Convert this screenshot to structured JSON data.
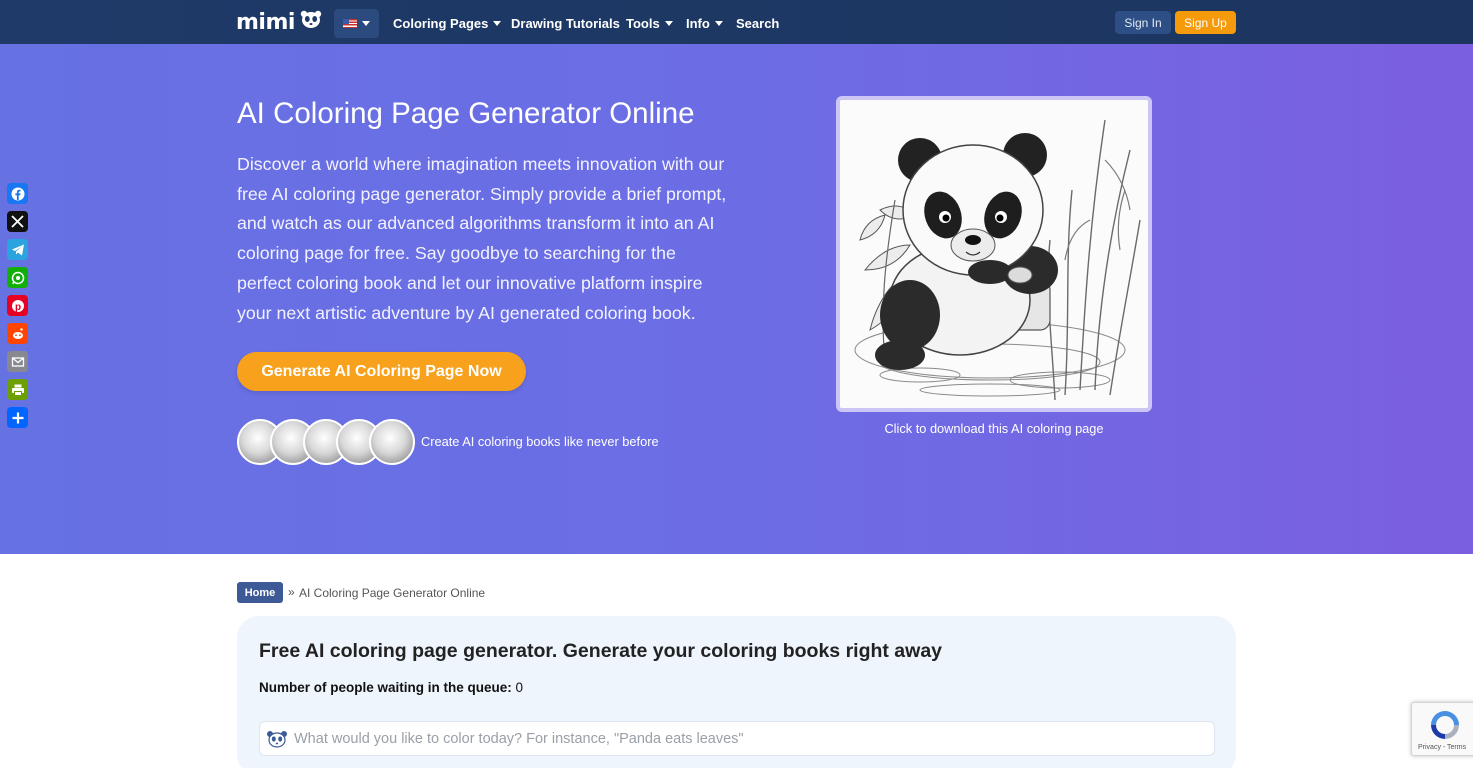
{
  "nav": {
    "logo_text": "mimi",
    "language_flag": "us-flag-icon",
    "items": [
      {
        "label": "Coloring Pages",
        "has_dropdown": true
      },
      {
        "label": "Drawing Tutorials",
        "has_dropdown": false
      },
      {
        "label": "Tools",
        "has_dropdown": true
      },
      {
        "label": "Info",
        "has_dropdown": true
      },
      {
        "label": "Search",
        "has_dropdown": false
      }
    ],
    "sign_in": "Sign In",
    "sign_up": "Sign Up"
  },
  "hero": {
    "title": "AI Coloring Page Generator Online",
    "description": "Discover a world where imagination meets innovation with our free AI coloring page generator. Simply provide a brief prompt, and watch as our advanced algorithms transform it into an AI coloring page for free. Say goodbye to searching for the perfect coloring book and let our innovative platform inspire your next artistic adventure by AI generated coloring book.",
    "cta_label": "Generate AI Coloring Page Now",
    "avatars_caption": "Create AI coloring books like never before",
    "preview_caption": "Click to download this AI coloring page"
  },
  "share": {
    "buttons": [
      {
        "name": "facebook-icon",
        "color": "#1877f2"
      },
      {
        "name": "x-icon",
        "color": "#111111"
      },
      {
        "name": "telegram-icon",
        "color": "#2aa3df"
      },
      {
        "name": "whatsapp-icon",
        "color": "#12af0a"
      },
      {
        "name": "pinterest-icon",
        "color": "#e60023"
      },
      {
        "name": "reddit-icon",
        "color": "#ff4500"
      },
      {
        "name": "email-icon",
        "color": "#888990"
      },
      {
        "name": "print-icon",
        "color": "#6d9f00"
      },
      {
        "name": "share-plus-icon",
        "color": "#0166ff"
      }
    ]
  },
  "breadcrumb": {
    "home": "Home",
    "separator": "»",
    "current": "AI Coloring Page Generator Online"
  },
  "generator": {
    "title": "Free AI coloring page generator. Generate your coloring books right away",
    "queue_label": "Number of people waiting in the queue:",
    "queue_count": "0",
    "prompt_placeholder": "What would you like to color today? For instance, \"Panda eats leaves\"",
    "prompt_value": ""
  },
  "recaptcha": {
    "footer": "Privacy - Terms"
  },
  "colors": {
    "accent_orange": "#f59a0b",
    "nav_bg": "#1f3a68",
    "hero_gradient_start": "#6671e2",
    "hero_gradient_end": "#7b5fe0"
  }
}
